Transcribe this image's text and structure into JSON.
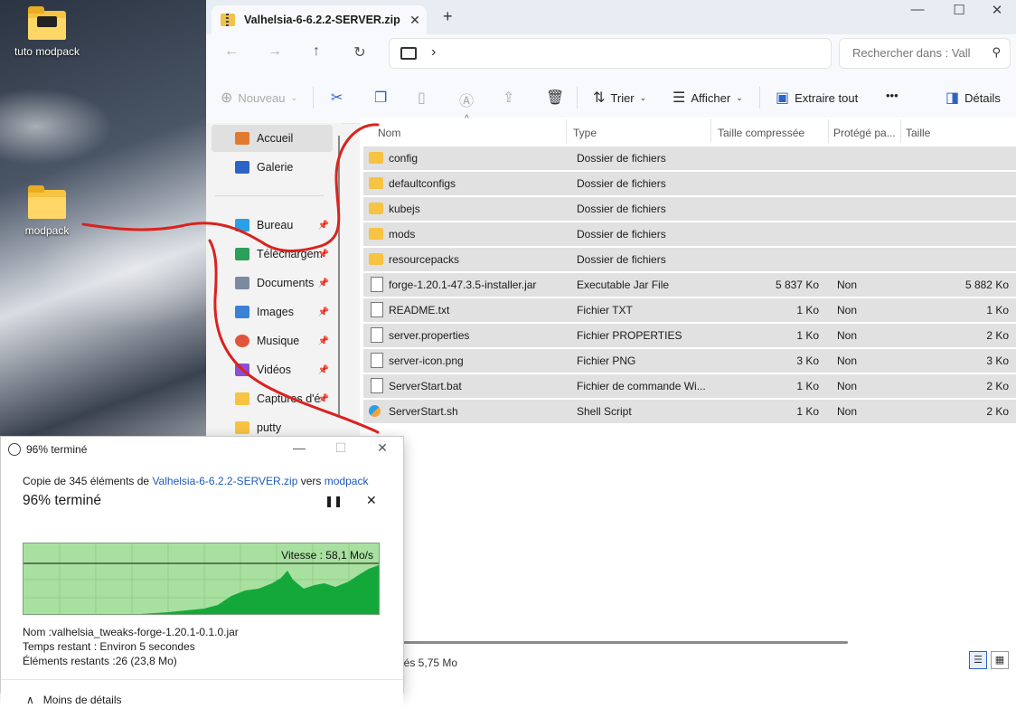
{
  "desktop": {
    "icons": [
      {
        "label": "tuto modpack"
      },
      {
        "label": "modpack"
      }
    ]
  },
  "explorer": {
    "tab_title": "Valhelsia-6-6.2.2-SERVER.zip",
    "tab_close": "✕",
    "new_tab": "+",
    "window_controls": {
      "minimize": "—",
      "maximize": "☐",
      "close": "✕"
    },
    "nav": {
      "back": "←",
      "forward": "→",
      "up": "↑",
      "refresh": "↻",
      "chevron": "›"
    },
    "search_placeholder": "Rechercher dans : Vall",
    "toolbar": {
      "new": "Nouveau",
      "sort": "Trier",
      "view": "Afficher",
      "extract": "Extraire tout",
      "more": "•••",
      "details": "Détails"
    },
    "sidebar": [
      {
        "label": "Accueil",
        "color": "#e07a2e"
      },
      {
        "label": "Galerie",
        "color": "#2b63c7"
      },
      {
        "label": "Bureau",
        "color": "#2aa0e8"
      },
      {
        "label": "Téléchargem",
        "color": "#2aa05a"
      },
      {
        "label": "Documents",
        "color": "#7a8aa0"
      },
      {
        "label": "Images",
        "color": "#3b82d6"
      },
      {
        "label": "Musique",
        "color": "#e0553b"
      },
      {
        "label": "Vidéos",
        "color": "#8a4fd6"
      },
      {
        "label": "Captures d'é",
        "color": "#f6c342"
      },
      {
        "label": "putty",
        "color": "#f6c342"
      }
    ],
    "columns": {
      "name": "Nom",
      "type": "Type",
      "compressed": "Taille compressée",
      "protected": "Protégé pa...",
      "size": "Taille"
    },
    "files": [
      {
        "name": "config",
        "type": "Dossier de fichiers",
        "compressed": "",
        "protected": "",
        "size": "",
        "icon": "folder"
      },
      {
        "name": "defaultconfigs",
        "type": "Dossier de fichiers",
        "compressed": "",
        "protected": "",
        "size": "",
        "icon": "folder"
      },
      {
        "name": "kubejs",
        "type": "Dossier de fichiers",
        "compressed": "",
        "protected": "",
        "size": "",
        "icon": "folder"
      },
      {
        "name": "mods",
        "type": "Dossier de fichiers",
        "compressed": "",
        "protected": "",
        "size": "",
        "icon": "folder"
      },
      {
        "name": "resourcepacks",
        "type": "Dossier de fichiers",
        "compressed": "",
        "protected": "",
        "size": "",
        "icon": "folder"
      },
      {
        "name": "forge-1.20.1-47.3.5-installer.jar",
        "type": "Executable Jar File",
        "compressed": "5 837 Ko",
        "protected": "Non",
        "size": "5 882 Ko",
        "icon": "file"
      },
      {
        "name": "README.txt",
        "type": "Fichier TXT",
        "compressed": "1 Ko",
        "protected": "Non",
        "size": "1 Ko",
        "icon": "file"
      },
      {
        "name": "server.properties",
        "type": "Fichier PROPERTIES",
        "compressed": "1 Ko",
        "protected": "Non",
        "size": "2 Ko",
        "icon": "file"
      },
      {
        "name": "server-icon.png",
        "type": "Fichier PNG",
        "compressed": "3 Ko",
        "protected": "Non",
        "size": "3 Ko",
        "icon": "file"
      },
      {
        "name": "ServerStart.bat",
        "type": "Fichier de commande Wi...",
        "compressed": "1 Ko",
        "protected": "Non",
        "size": "2 Ko",
        "icon": "file"
      },
      {
        "name": "ServerStart.sh",
        "type": "Shell Script",
        "compressed": "1 Ko",
        "protected": "Non",
        "size": "2 Ko",
        "icon": "sh"
      }
    ],
    "status": "nés 5,75 Mo"
  },
  "dialog": {
    "title": "96% terminé",
    "controls": {
      "minimize": "—",
      "maximize": "☐",
      "close": "✕"
    },
    "copy_prefix": "Copie de 345 éléments de ",
    "source": "Valhelsia-6-6.2.2-SERVER.zip",
    "copy_mid": " vers ",
    "destination": "modpack",
    "progress_title": "96% terminé",
    "progress": 0.96,
    "pause": "❚❚",
    "cancel": "✕",
    "speed": "Vitesse : 58,1 Mo/s",
    "name_label": "Nom : ",
    "name_value": "valhelsia_tweaks-forge-1.20.1-0.1.0.jar",
    "remaining_label": "Temps restant : ",
    "remaining_value": "Environ 5 secondes",
    "items_label": "Éléments restants : ",
    "items_value": "26 (23,8 Mo)",
    "less_details": "Moins de détails",
    "chevron": "∧"
  },
  "colors": {
    "accent": "#2b63c7",
    "graph_fill": "#14a83a",
    "graph_bg": "#a8e0a0",
    "annotation": "#d9231f"
  }
}
